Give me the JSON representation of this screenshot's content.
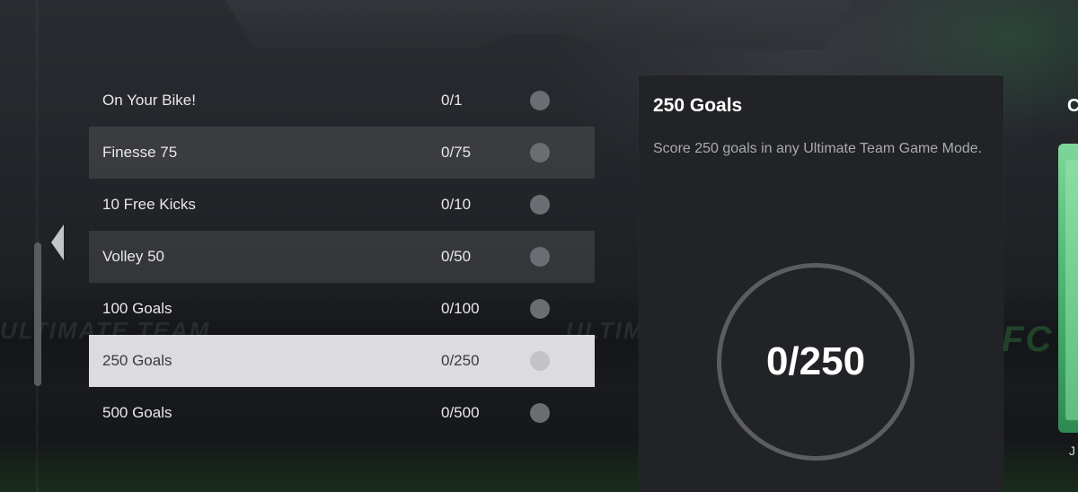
{
  "objectives": [
    {
      "title": "On Your Bike!",
      "progress": "0/1",
      "style": "plain"
    },
    {
      "title": "Finesse 75",
      "progress": "0/75",
      "style": "alt"
    },
    {
      "title": "10 Free Kicks",
      "progress": "0/10",
      "style": "plain"
    },
    {
      "title": "Volley 50",
      "progress": "0/50",
      "style": "alt"
    },
    {
      "title": "100 Goals",
      "progress": "0/100",
      "style": "plain"
    },
    {
      "title": "250 Goals",
      "progress": "0/250",
      "style": "selected"
    },
    {
      "title": "500 Goals",
      "progress": "0/500",
      "style": "plain"
    }
  ],
  "detail": {
    "title": "250 Goals",
    "description": "Score 250 goals in any Ultimate Team Game Mode.",
    "counter": "0/250"
  },
  "side_card": {
    "label": "C",
    "footer": "J"
  },
  "background_text": {
    "left": "ULTIMATE TEAM",
    "middle": "ULTIMATE TEAM",
    "right": "FC"
  },
  "colors": {
    "selected_row": "#dcdcde",
    "alt_row": "rgba(255,255,255,0.10)",
    "panel": "#222326",
    "ring": "#5c5d61",
    "card_green": "#4fb873"
  },
  "icons": {
    "nav_arrow": "chevron-left-icon",
    "status_dot": "status-dot-icon"
  }
}
